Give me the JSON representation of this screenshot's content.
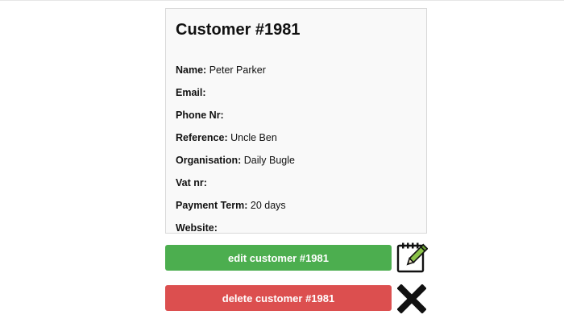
{
  "customer": {
    "title": "Customer #1981",
    "fields": [
      {
        "label": "Name:",
        "value": "Peter Parker"
      },
      {
        "label": "Email:",
        "value": ""
      },
      {
        "label": "Phone Nr:",
        "value": ""
      },
      {
        "label": "Reference:",
        "value": "Uncle Ben"
      },
      {
        "label": "Organisation:",
        "value": "Daily Bugle"
      },
      {
        "label": "Vat nr:",
        "value": ""
      },
      {
        "label": "Payment Term:",
        "value": "20 days"
      },
      {
        "label": "Website:",
        "value": ""
      }
    ]
  },
  "actions": {
    "edit_label": "edit customer #1981",
    "delete_label": "delete customer #1981",
    "edit_icon": "notepad-pencil-icon",
    "delete_icon": "close-x-icon"
  },
  "colors": {
    "edit_button": "#4cae4f",
    "delete_button": "#dc4f4f",
    "card_background": "#f9f9f9",
    "card_border": "#d9d9d9",
    "pencil_accent": "#8bc34a"
  }
}
